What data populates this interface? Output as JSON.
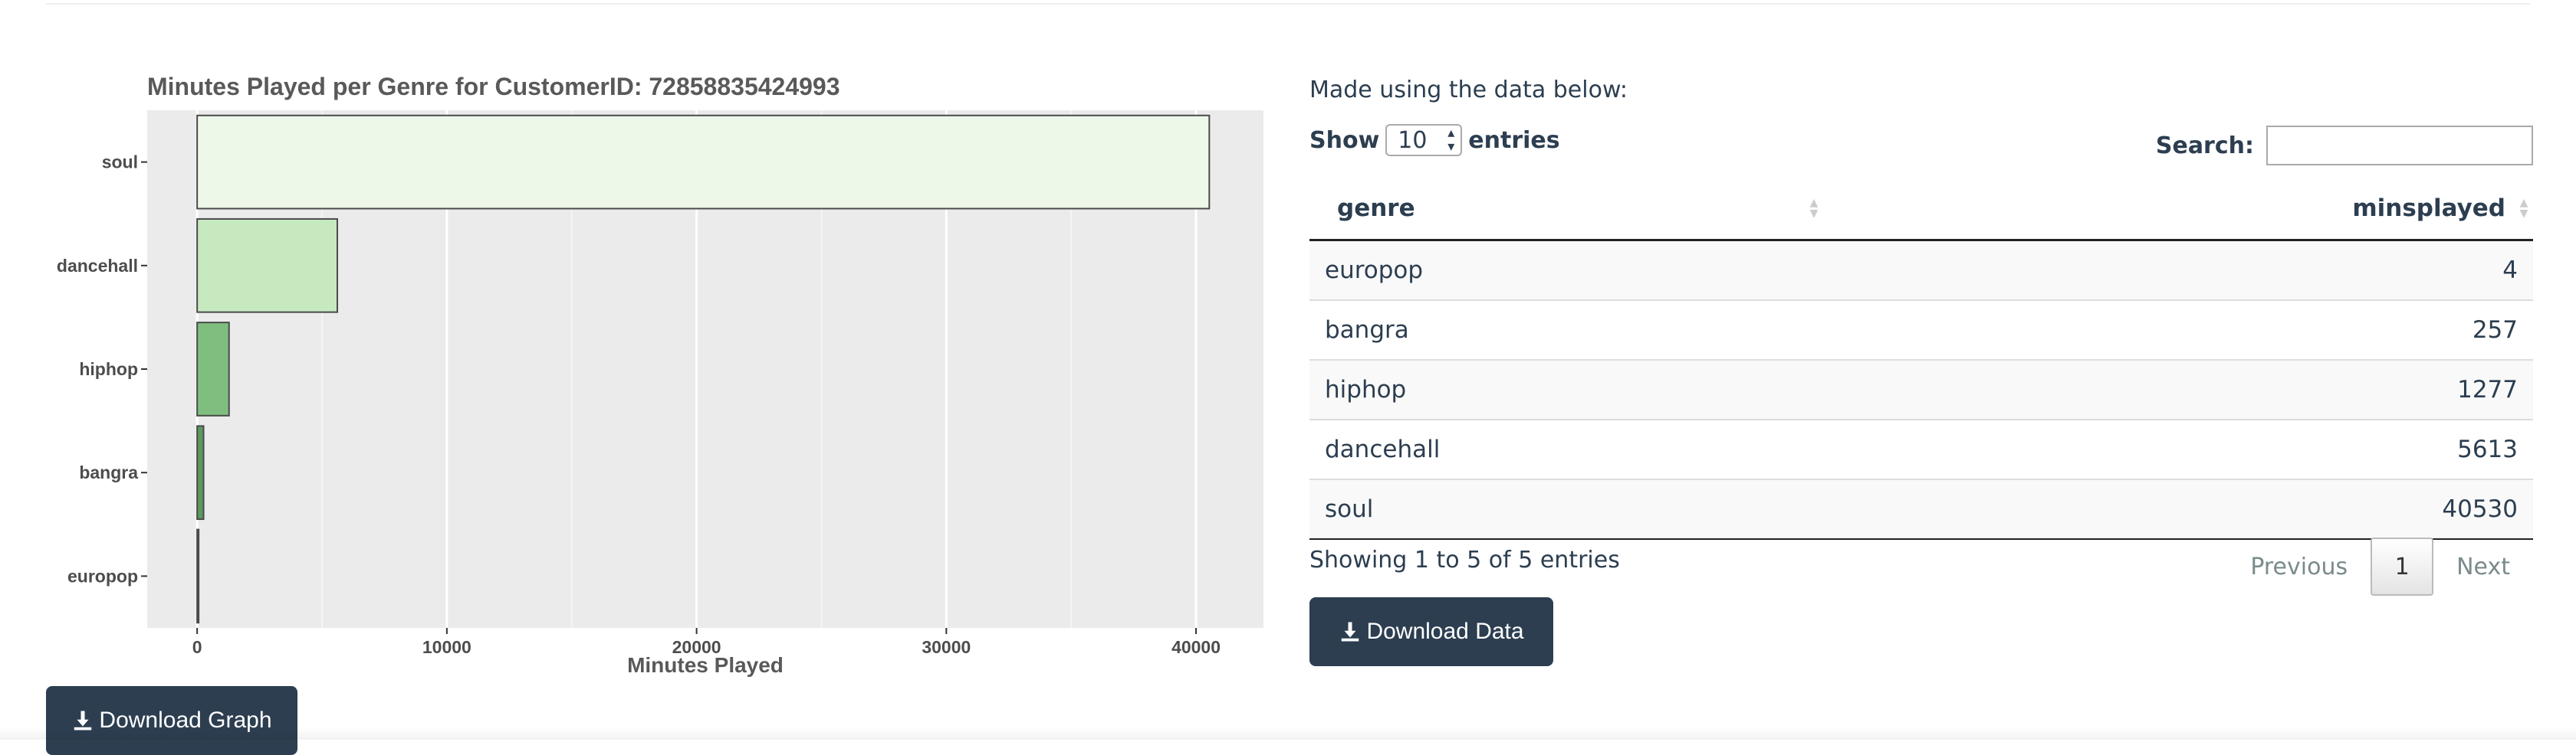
{
  "chart_data": {
    "type": "bar",
    "orientation": "horizontal",
    "title": "Minutes Played per Genre for CustomerID: 72858835424993",
    "xlabel": "Minutes Played",
    "ylabel": "",
    "categories": [
      "soul",
      "dancehall",
      "hiphop",
      "bangra",
      "europop"
    ],
    "values": [
      40530,
      5613,
      1277,
      257,
      4
    ],
    "xlim": [
      -2000,
      42700
    ],
    "xticks": [
      0,
      10000,
      20000,
      30000,
      40000
    ],
    "grid": true,
    "colors": [
      "#edf8e9",
      "#c7e9c0",
      "#7fbe7f",
      "#5a9a5e",
      "#2f6f3a"
    ]
  },
  "buttons": {
    "download_graph": "Download Graph",
    "download_data": "Download Data"
  },
  "panel": {
    "made_using": "Made using the data below:",
    "show_label": "Show",
    "entries_label": "entries",
    "page_length": "10",
    "search_label": "Search:",
    "search_value": ""
  },
  "table": {
    "headers": [
      "genre",
      "minsplayed"
    ],
    "rows": [
      [
        "europop",
        "4"
      ],
      [
        "bangra",
        "257"
      ],
      [
        "hiphop",
        "1277"
      ],
      [
        "dancehall",
        "5613"
      ],
      [
        "soul",
        "40530"
      ]
    ]
  },
  "footer": {
    "info": "Showing 1 to 5 of 5 entries",
    "previous": "Previous",
    "current_page": "1",
    "next": "Next"
  },
  "icons": [
    "download-icon",
    "sort-icon",
    "select-arrow-icon"
  ]
}
